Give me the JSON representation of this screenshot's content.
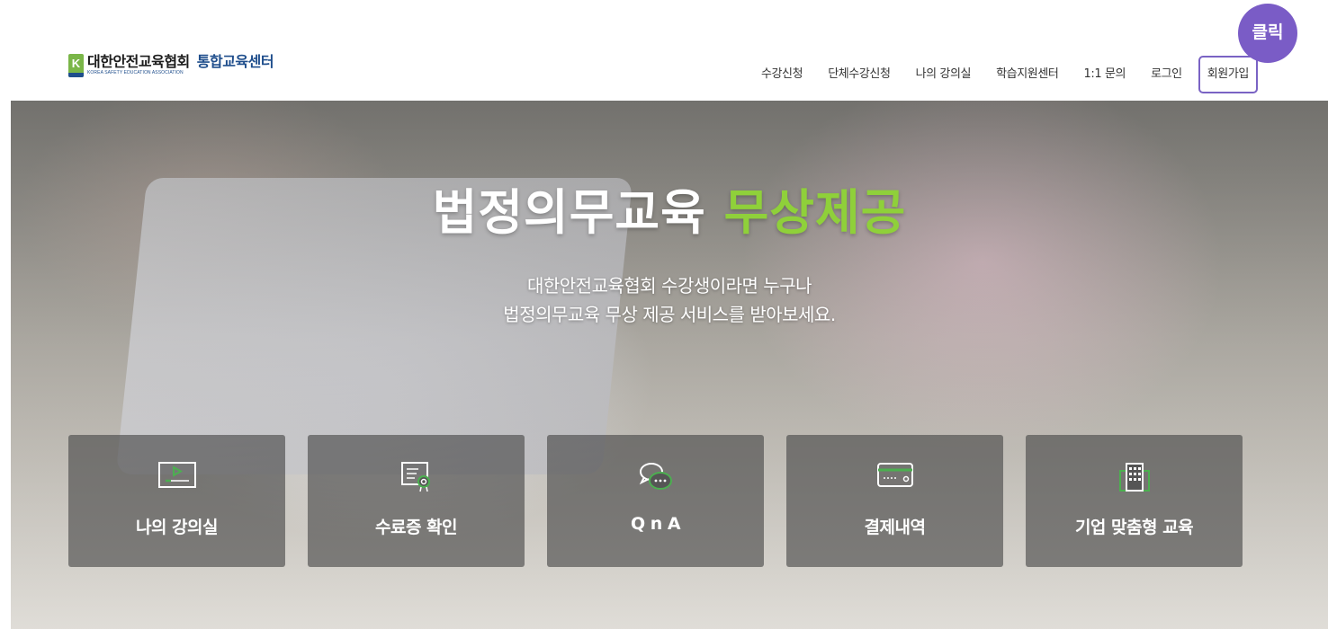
{
  "logo": {
    "mark": "K",
    "name": "대한안전교육협회",
    "sub": "KOREA SAFETY EDUCATION ASSOCIATION",
    "center": "통합교육센터"
  },
  "nav": {
    "items": [
      "수강신청",
      "단체수강신청",
      "나의 강의실",
      "학습지원센터",
      "1:1 문의",
      "로그인"
    ],
    "signup": "회원가입"
  },
  "callout": "클릭",
  "hero": {
    "title_white": "법정의무교육",
    "title_green": "무상제공",
    "sub_line1": "대한안전교육협회 수강생이라면 누구나",
    "sub_line2": "법정의무교육 무상 제공 서비스를 받아보세요."
  },
  "cards": [
    {
      "label": "나의 강의실",
      "icon": "video-player-icon"
    },
    {
      "label": "수료증 확인",
      "icon": "certificate-icon"
    },
    {
      "label": "Q n A",
      "icon": "chat-bubbles-icon"
    },
    {
      "label": "결제내역",
      "icon": "credit-card-icon"
    },
    {
      "label": "기업 맞춤형 교육",
      "icon": "building-icon"
    }
  ],
  "colors": {
    "accent_purple": "#7a5cc6",
    "title_green": "#8fd03a",
    "icon_green": "#4caf50",
    "brand_navy": "#1f4e8c"
  }
}
